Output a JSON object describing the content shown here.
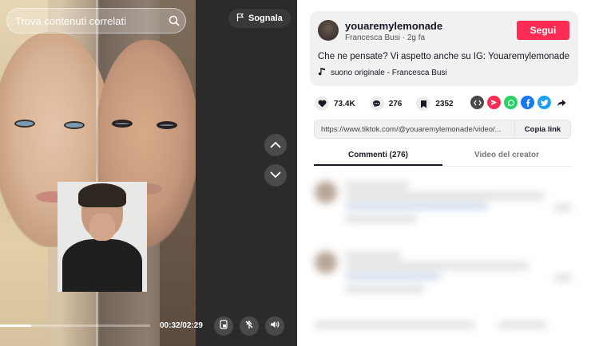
{
  "video": {
    "search": {
      "placeholder": "Trova contenuti correlati"
    },
    "report_label": "Sognala",
    "time": "00:32/02:29",
    "progress": 0.21
  },
  "author": {
    "username": "youaremylemonade",
    "display_name": "Francesca Busi",
    "separator": "·",
    "posted": "2g fa",
    "follow_label": "Segui"
  },
  "caption": "Che ne pensate? Vi aspetto anche su IG: Youaremylemonade",
  "sound": "suono originale - Francesca Busi",
  "stats": {
    "likes": "73.4K",
    "comments": "276",
    "saves": "2352"
  },
  "share_icons": [
    "embed-icon",
    "send-icon",
    "whatsapp-icon",
    "facebook-icon",
    "twitter-icon",
    "share-arrow-icon"
  ],
  "link": {
    "url": "https://www.tiktok.com/@youaremylemonade/video/...",
    "copy_label": "Copia link"
  },
  "tabs": [
    {
      "label": "Commenti (276)",
      "active": true
    },
    {
      "label": "Video del creator",
      "active": false
    }
  ],
  "colors": {
    "accent": "#fe2c55",
    "text": "#161823"
  }
}
